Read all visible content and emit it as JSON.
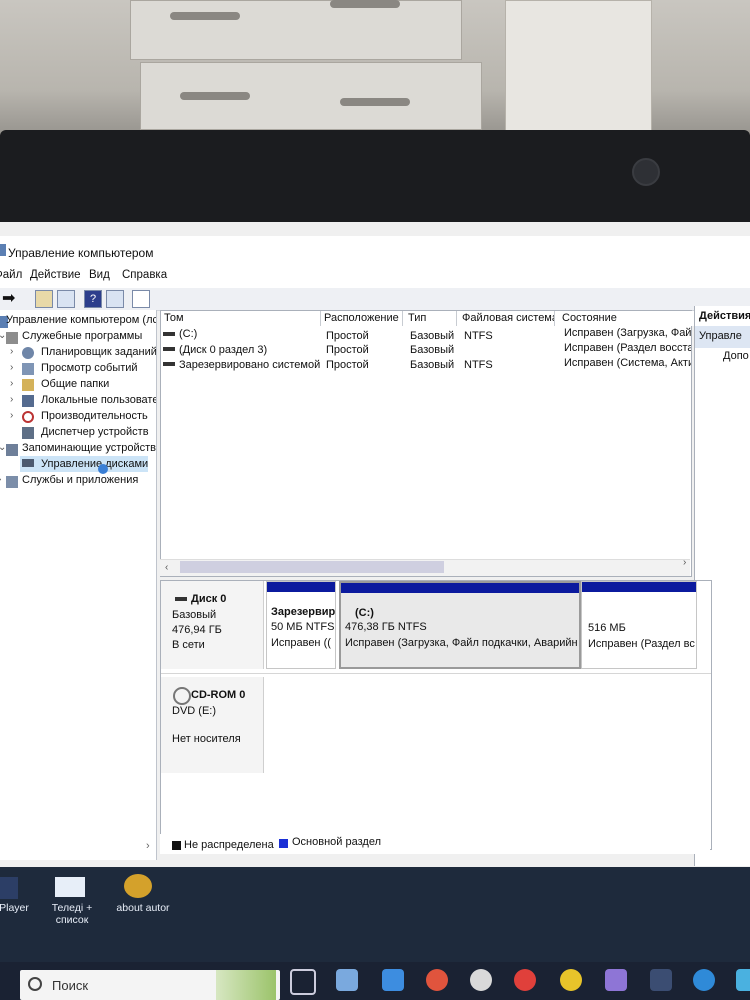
{
  "window": {
    "title": "Управление компьютером",
    "menu": [
      "Файл",
      "Действие",
      "Вид",
      "Справка"
    ]
  },
  "tree": {
    "root": "Управление компьютером (лс",
    "system_tools": "Служебные программы",
    "items": [
      "Планировщик заданий",
      "Просмотр событий",
      "Общие папки",
      "Локальные пользовате",
      "Производительность",
      "Диспетчер устройств"
    ],
    "storage": "Запоминающие устройств",
    "disk_management": "Управление дисками",
    "services": "Службы и приложения"
  },
  "volume_list": {
    "columns": [
      "Том",
      "Расположение",
      "Тип",
      "Файловая система",
      "Состояние"
    ],
    "rows": [
      {
        "name": "(C:)",
        "layout": "Простой",
        "type": "Базовый",
        "fs": "NTFS",
        "status": "Исправен (Загрузка, Файл"
      },
      {
        "name": "(Диск 0 раздел 3)",
        "layout": "Простой",
        "type": "Базовый",
        "fs": "",
        "status": "Исправен (Раздел восстан"
      },
      {
        "name": "Зарезервировано системой",
        "layout": "Простой",
        "type": "Базовый",
        "fs": "NTFS",
        "status": "Исправен (Система, Актив"
      }
    ]
  },
  "actions": {
    "header": "Действия",
    "selected": "Управле",
    "more": "Допо"
  },
  "disk0": {
    "name": "Диск 0",
    "type": "Базовый",
    "size": "476,94 ГБ",
    "status": "В сети",
    "partitions": [
      {
        "title": "Зарезервир",
        "size": "50 МБ NTFS",
        "status": "Исправен (("
      },
      {
        "title": "(C:)",
        "size": "476,38 ГБ NTFS",
        "status": "Исправен (Загрузка, Файл подкачки, Аварийн"
      },
      {
        "title": "",
        "size": "516 МБ",
        "status": "Исправен (Раздел вс"
      }
    ]
  },
  "cdrom": {
    "name": "CD-ROM 0",
    "drive": "DVD (E:)",
    "status": "Нет носителя"
  },
  "legend": {
    "unallocated": "Не распределена",
    "primary": "Основной раздел"
  },
  "desktop_icons": [
    "Player",
    "Теледі + список",
    "about autor"
  ],
  "taskbar": {
    "search_placeholder": "Поиск"
  },
  "colors": {
    "partition_bar": "#0b1a9e",
    "unallocated": "#111111",
    "primary": "#1a2fd6",
    "selected_tree": "#cce4f7"
  }
}
